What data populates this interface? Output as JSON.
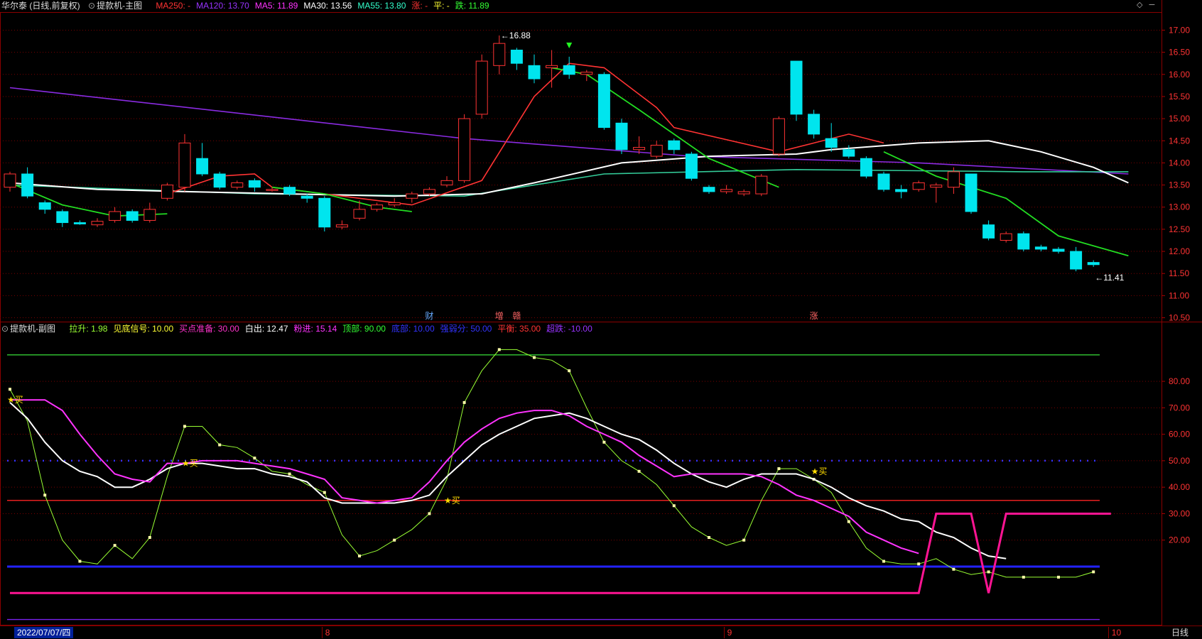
{
  "main_header": {
    "stock": "华尔泰 (日线,前复权)",
    "indicator": "提款机-主图",
    "items": [
      {
        "label": "MA250: -",
        "color": "#ff3333"
      },
      {
        "label": "MA120: 13.70",
        "color": "#9933ff"
      },
      {
        "label": "MA5: 11.89",
        "color": "#ff33ff"
      },
      {
        "label": "MA30: 13.56",
        "color": "#ffffff"
      },
      {
        "label": "MA55: 13.80",
        "color": "#33ffcc"
      },
      {
        "label": "涨: -",
        "color": "#ff3333"
      },
      {
        "label": "平: -",
        "color": "#ffff33"
      },
      {
        "label": "跌: 11.89",
        "color": "#33ff33"
      }
    ]
  },
  "sub_header": {
    "indicator": "提款机-副图",
    "items": [
      {
        "label": "拉升: 1.98",
        "color": "#99ff33"
      },
      {
        "label": "见底信号: 10.00",
        "color": "#ffff33"
      },
      {
        "label": "买点准备: 30.00",
        "color": "#ff33cc"
      },
      {
        "label": "白出: 12.47",
        "color": "#ffffff"
      },
      {
        "label": "粉进: 15.14",
        "color": "#ff33ff"
      },
      {
        "label": "顶部: 90.00",
        "color": "#33ff33"
      },
      {
        "label": "底部: 10.00",
        "color": "#3333ff"
      },
      {
        "label": "强弱分: 50.00",
        "color": "#3333ff"
      },
      {
        "label": "平衡: 35.00",
        "color": "#ff3333"
      },
      {
        "label": "超跌: -10.00",
        "color": "#9933ff"
      }
    ]
  },
  "controls": {
    "diamond": "◇",
    "minimize": "─"
  },
  "bottom_bar": {
    "date": "2022/07/07/四",
    "month_labels": [
      {
        "text": "8",
        "index": 18
      },
      {
        "text": "9",
        "index": 41
      },
      {
        "text": "10",
        "index": 63
      }
    ],
    "period": "日线"
  },
  "chart_data": [
    {
      "type": "candlestick",
      "title": "提款机-主图",
      "y_ticks": [
        10.5,
        11.0,
        11.5,
        12.0,
        12.5,
        13.0,
        13.5,
        14.0,
        14.5,
        15.0,
        15.5,
        16.0,
        16.5,
        17.0
      ],
      "ylim": [
        10.3,
        17.2
      ],
      "candles": [
        [
          13.45,
          13.75,
          13.8,
          13.35
        ],
        [
          13.75,
          13.25,
          13.9,
          13.2
        ],
        [
          13.1,
          12.95,
          13.15,
          12.85
        ],
        [
          12.9,
          12.65,
          12.95,
          12.55
        ],
        [
          12.65,
          12.62,
          12.7,
          12.6
        ],
        [
          12.6,
          12.68,
          12.75,
          12.55
        ],
        [
          12.7,
          12.9,
          13.0,
          12.65
        ],
        [
          12.9,
          12.7,
          12.95,
          12.65
        ],
        [
          12.7,
          12.95,
          13.1,
          12.65
        ],
        [
          13.2,
          13.5,
          13.55,
          13.15
        ],
        [
          13.45,
          14.45,
          14.65,
          13.35
        ],
        [
          14.1,
          13.75,
          14.45,
          13.7
        ],
        [
          13.75,
          13.45,
          13.8,
          13.4
        ],
        [
          13.45,
          13.55,
          13.6,
          13.4
        ],
        [
          13.6,
          13.45,
          13.65,
          13.35
        ],
        [
          13.4,
          13.4,
          13.45,
          13.35
        ],
        [
          13.45,
          13.3,
          13.5,
          13.25
        ],
        [
          13.25,
          13.2,
          13.3,
          13.1
        ],
        [
          13.2,
          12.55,
          13.25,
          12.45
        ],
        [
          12.55,
          12.6,
          12.7,
          12.5
        ],
        [
          12.75,
          12.95,
          13.15,
          12.7
        ],
        [
          12.95,
          13.05,
          13.1,
          12.9
        ],
        [
          13.05,
          13.1,
          13.2,
          13.0
        ],
        [
          13.2,
          13.3,
          13.35,
          13.1
        ],
        [
          13.3,
          13.4,
          13.45,
          13.25
        ],
        [
          13.5,
          13.6,
          13.7,
          13.45
        ],
        [
          13.6,
          15.0,
          15.1,
          13.55
        ],
        [
          15.1,
          16.3,
          16.45,
          15.0
        ],
        [
          16.2,
          16.7,
          16.88,
          16.0
        ],
        [
          16.55,
          16.25,
          16.6,
          16.1
        ],
        [
          16.2,
          15.9,
          16.45,
          15.8
        ],
        [
          16.15,
          16.2,
          16.55,
          15.7
        ],
        [
          16.2,
          16.0,
          16.4,
          15.9
        ],
        [
          16.0,
          16.05,
          16.1,
          15.85
        ],
        [
          16.0,
          14.8,
          16.05,
          14.75
        ],
        [
          14.9,
          14.3,
          15.0,
          14.2
        ],
        [
          14.3,
          14.35,
          14.6,
          14.2
        ],
        [
          14.15,
          14.4,
          14.5,
          14.1
        ],
        [
          14.5,
          14.3,
          14.55,
          14.2
        ],
        [
          14.2,
          13.65,
          14.25,
          13.6
        ],
        [
          13.45,
          13.35,
          13.5,
          13.3
        ],
        [
          13.35,
          13.4,
          13.5,
          13.3
        ],
        [
          13.3,
          13.35,
          13.4,
          13.25
        ],
        [
          13.3,
          13.7,
          13.75,
          13.25
        ],
        [
          14.2,
          15.0,
          15.05,
          14.15
        ],
        [
          16.3,
          15.1,
          16.3,
          14.95
        ],
        [
          15.1,
          14.65,
          15.2,
          14.55
        ],
        [
          14.55,
          14.35,
          14.9,
          14.25
        ],
        [
          14.3,
          14.15,
          14.4,
          14.1
        ],
        [
          14.1,
          13.7,
          14.15,
          13.65
        ],
        [
          13.75,
          13.4,
          13.8,
          13.35
        ],
        [
          13.4,
          13.35,
          13.5,
          13.2
        ],
        [
          13.4,
          13.55,
          13.6,
          13.35
        ],
        [
          13.45,
          13.5,
          13.55,
          13.1
        ],
        [
          13.45,
          13.8,
          13.9,
          13.3
        ],
        [
          13.75,
          12.9,
          13.75,
          12.85
        ],
        [
          12.6,
          12.3,
          12.7,
          12.25
        ],
        [
          12.25,
          12.4,
          12.45,
          12.2
        ],
        [
          12.4,
          12.05,
          12.45,
          12.0
        ],
        [
          12.1,
          12.05,
          12.15,
          12.0
        ],
        [
          12.05,
          12.0,
          12.1,
          11.95
        ],
        [
          12.0,
          11.6,
          12.1,
          11.55
        ],
        [
          11.75,
          11.7,
          11.8,
          11.65
        ]
      ],
      "series": [
        {
          "name": "MA120",
          "color": "#8a2be2",
          "values": [
            [
              0,
              15.7
            ],
            [
              26,
              14.55
            ],
            [
              39,
              14.15
            ],
            [
              52,
              14.0
            ],
            [
              64,
              13.75
            ]
          ]
        },
        {
          "name": "MA55",
          "color": "#33cc99",
          "values": [
            [
              0,
              13.5
            ],
            [
              14,
              13.3
            ],
            [
              26,
              13.25
            ],
            [
              34,
              13.75
            ],
            [
              45,
              13.85
            ],
            [
              58,
              13.8
            ],
            [
              64,
              13.8
            ]
          ]
        },
        {
          "name": "MA30",
          "color": "#ffffff",
          "values": [
            [
              0,
              13.55
            ],
            [
              5,
              13.4
            ],
            [
              10,
              13.35
            ],
            [
              22,
              13.25
            ],
            [
              27,
              13.3
            ],
            [
              30,
              13.55
            ],
            [
              35,
              14.0
            ],
            [
              40,
              14.15
            ],
            [
              45,
              14.2
            ],
            [
              47,
              14.3
            ],
            [
              52,
              14.45
            ],
            [
              56,
              14.5
            ],
            [
              59,
              14.25
            ],
            [
              62,
              13.9
            ],
            [
              64,
              13.55
            ]
          ]
        },
        {
          "name": "MA5",
          "color": "#ff3333",
          "values": [
            [
              9,
              13.3
            ],
            [
              12,
              13.7
            ],
            [
              14,
              13.75
            ],
            [
              15,
              13.45
            ],
            [
              23,
              13.05
            ],
            [
              27,
              13.6
            ],
            [
              30,
              15.5
            ],
            [
              32,
              16.25
            ],
            [
              34,
              16.15
            ],
            [
              37,
              15.25
            ],
            [
              38,
              14.8
            ],
            [
              44,
              14.25
            ],
            [
              46,
              14.45
            ],
            [
              48,
              14.65
            ],
            [
              50,
              14.45
            ]
          ]
        }
      ],
      "annotations": [
        {
          "text": "16.88",
          "index": 28,
          "value": 16.88
        },
        {
          "text": "11.41",
          "index": 62,
          "value": 11.41
        },
        {
          "text": "财",
          "index": 24,
          "color": "#66aaff"
        },
        {
          "text": "增",
          "index": 28,
          "color": "#ff6666"
        },
        {
          "text": "赣",
          "index": 29,
          "color": "#ff6666"
        },
        {
          "text": "涨",
          "index": 46,
          "color": "#ff6666"
        }
      ]
    },
    {
      "type": "line",
      "title": "提款机-副图",
      "y_ticks": [
        20.0,
        30.0,
        40.0,
        50.0,
        60.0,
        70.0,
        80.0
      ],
      "ylim": [
        -12,
        98
      ],
      "hlines": [
        {
          "name": "顶部",
          "value": 90,
          "color": "#33cc33"
        },
        {
          "name": "强弱分",
          "value": 50,
          "color": "#3333ff"
        },
        {
          "name": "平衡",
          "value": 35,
          "color": "#ff2222"
        },
        {
          "name": "底部",
          "value": 10,
          "color": "#2222ff"
        },
        {
          "name": "超跌",
          "value": -10,
          "color": "#7a22ee"
        }
      ],
      "series": [
        {
          "name": "拉升",
          "color": "#99ff33",
          "values": [
            77,
            65,
            37,
            20,
            12,
            11,
            18,
            13,
            21,
            44,
            63,
            63,
            56,
            55,
            51,
            46,
            45,
            41,
            38,
            22,
            14,
            16,
            20,
            24,
            30,
            43,
            72,
            84,
            92,
            92,
            89,
            88,
            84,
            70,
            57,
            50,
            46,
            41,
            33,
            25,
            21,
            18,
            20,
            35,
            47,
            47,
            43,
            38,
            27,
            17,
            12,
            11,
            11,
            13,
            9,
            7,
            8,
            6,
            6,
            6,
            6,
            6,
            8
          ]
        },
        {
          "name": "白出",
          "color": "#ffffff",
          "values": [
            72,
            66,
            57,
            50,
            46,
            44,
            40,
            40,
            43,
            47,
            49,
            49,
            48,
            47,
            47,
            45,
            44,
            42,
            36,
            34,
            34,
            34,
            34,
            35,
            37,
            44,
            50,
            56,
            60,
            63,
            66,
            67,
            68,
            66,
            63,
            60,
            58,
            54,
            49,
            45,
            42,
            40,
            43,
            45,
            45,
            45,
            43,
            40,
            36,
            33,
            31,
            28,
            27,
            23,
            21,
            17,
            14,
            13
          ]
        },
        {
          "name": "粉进",
          "color": "#ff33ff",
          "values": [
            73,
            73,
            73,
            69,
            60,
            52,
            45,
            43,
            42,
            49,
            49,
            50,
            50,
            50,
            49,
            48,
            47,
            45,
            43,
            36,
            35,
            34,
            35,
            36,
            42,
            50,
            57,
            62,
            66,
            68,
            69,
            69,
            67,
            63,
            60,
            57,
            52,
            48,
            44,
            45,
            45,
            45,
            45,
            44,
            41,
            37,
            35,
            32,
            29,
            23,
            20,
            17,
            15
          ]
        },
        {
          "name": "买点准备",
          "color": "#ff1493",
          "values": [
            0,
            0,
            0,
            0,
            0,
            0,
            0,
            0,
            0,
            0,
            0,
            0,
            0,
            0,
            0,
            0,
            0,
            0,
            0,
            0,
            0,
            0,
            0,
            0,
            0,
            0,
            0,
            0,
            0,
            0,
            0,
            0,
            0,
            0,
            0,
            0,
            0,
            0,
            0,
            0,
            0,
            0,
            0,
            0,
            0,
            0,
            0,
            0,
            0,
            0,
            0,
            0,
            0,
            30,
            30,
            30,
            0,
            30,
            30,
            30,
            30,
            30,
            30,
            30
          ]
        }
      ],
      "markers": [
        {
          "text": "★买",
          "index": 0,
          "value": 73
        },
        {
          "text": "★买",
          "index": 10,
          "value": 49
        },
        {
          "text": "★买",
          "index": 25,
          "value": 35
        },
        {
          "text": "★买",
          "index": 46,
          "value": 46
        }
      ]
    }
  ]
}
